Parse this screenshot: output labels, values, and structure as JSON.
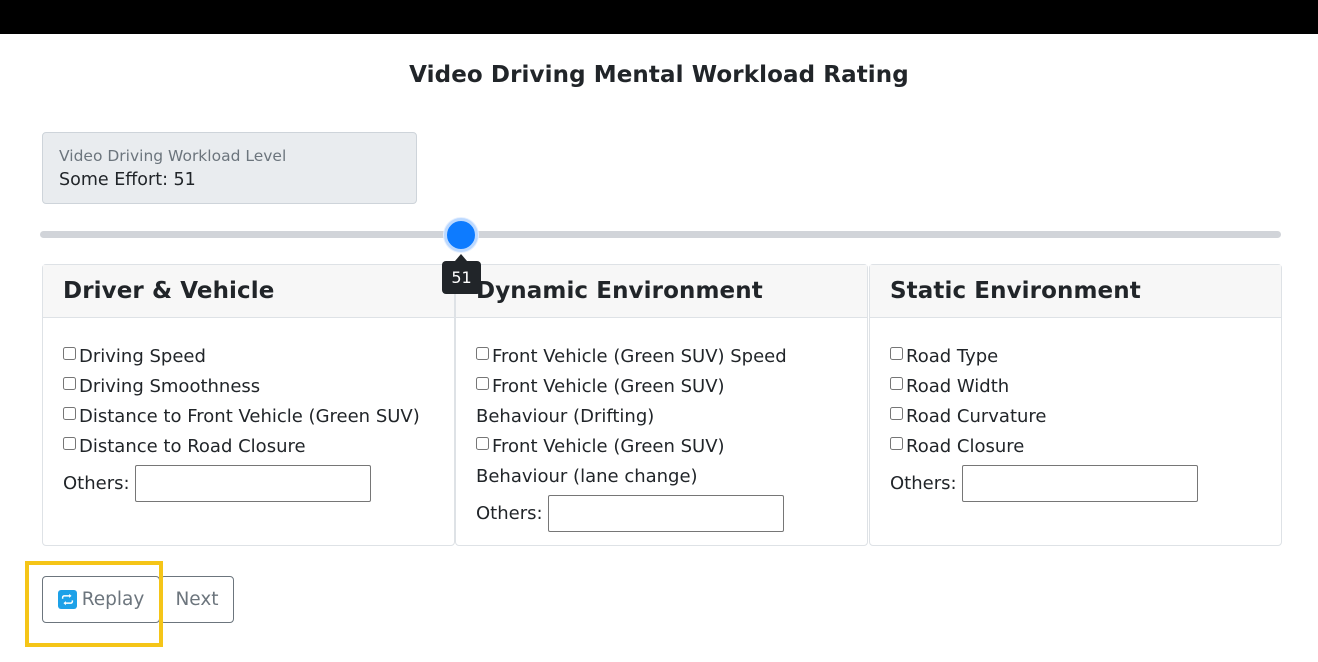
{
  "page": {
    "title": "Video Driving Mental Workload Rating"
  },
  "workload": {
    "label": "Video Driving Workload Level",
    "value_text": "Some Effort: 51"
  },
  "slider": {
    "value": 51,
    "min": 0,
    "max": 100,
    "tooltip": "51",
    "accent_color": "#0d7bff"
  },
  "cards": {
    "driver": {
      "title": "Driver & Vehicle",
      "options": [
        "Driving Speed",
        "Driving Smoothness",
        "Distance to Front Vehicle (Green SUV)",
        "Distance to Road Closure"
      ],
      "others_label": "Others:"
    },
    "dynamic": {
      "title": "Dynamic Environment",
      "options": [
        "Front Vehicle (Green SUV) Speed",
        "Front Vehicle (Green SUV) Behaviour (Drifting)",
        "Front Vehicle (Green SUV) Behaviour (lane change)"
      ],
      "others_label": "Others:"
    },
    "static": {
      "title": "Static Environment",
      "options": [
        "Road Type",
        "Road Width",
        "Road Curvature",
        "Road Closure"
      ],
      "others_label": "Others:"
    }
  },
  "buttons": {
    "replay": "Replay",
    "next": "Next",
    "replay_icon": "replay-icon"
  },
  "colors": {
    "highlight": "#f5c518"
  }
}
